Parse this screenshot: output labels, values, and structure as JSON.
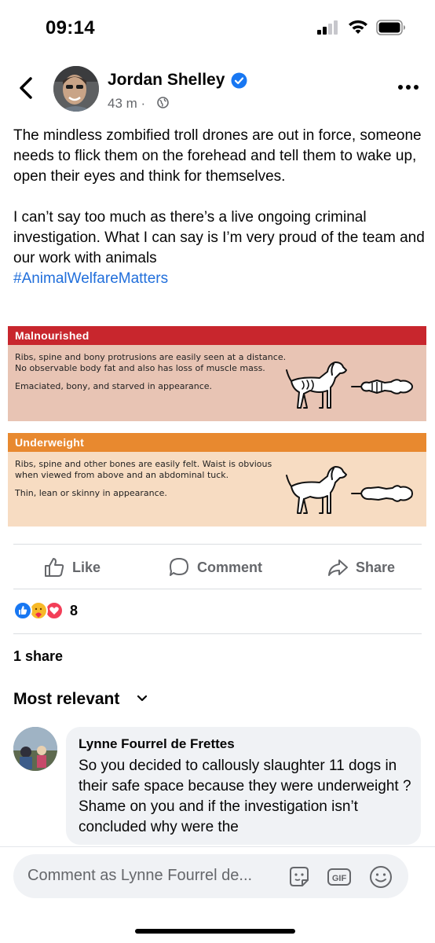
{
  "status_bar": {
    "time": "09:14"
  },
  "post": {
    "author": "Jordan Shelley",
    "time": "43 m ·",
    "paragraphs": [
      "The mindless zombified troll drones are out in force, someone needs to flick them on the forehead and tell them to wake up, open their eyes and think for themselves.",
      "I can’t say too much as there’s a live ongoing criminal investigation. What I can say is I’m very proud of the team and our work with animals"
    ],
    "hashtag": "#AnimalWelfareMatters"
  },
  "infographic": {
    "cards": [
      {
        "title": "Malnourished",
        "lines": [
          "Ribs, spine and bony protrusions are easily seen at a distance.",
          "No observable body fat and also has loss of muscle mass."
        ],
        "appearance": "Emaciated, bony, and starved in appearance.",
        "color": "#c8262d"
      },
      {
        "title": "Underweight",
        "lines": [
          "Ribs, spine and other bones are easily felt. Waist is obvious",
          "when viewed from above and an abdominal tuck."
        ],
        "appearance": "Thin, lean or skinny in appearance.",
        "color": "#e8892f"
      }
    ]
  },
  "actions": {
    "like": "Like",
    "comment": "Comment",
    "share": "Share"
  },
  "reactions": {
    "count": "8",
    "types": [
      "like-icon",
      "care-icon",
      "love-icon"
    ]
  },
  "shares": "1 share",
  "comments_sort": "Most relevant",
  "comment": {
    "author": "Lynne Fourrel de Frettes",
    "text": "So you decided to callously slaughter 11 dogs in their safe space because they were underweight ? Shame on you and if the investigation isn’t concluded why were the"
  },
  "composer": {
    "placeholder": "Comment as Lynne Fourrel de..."
  },
  "colors": {
    "link": "#216fdb",
    "verified": "#1877f2",
    "secondary_text": "#65676b"
  }
}
